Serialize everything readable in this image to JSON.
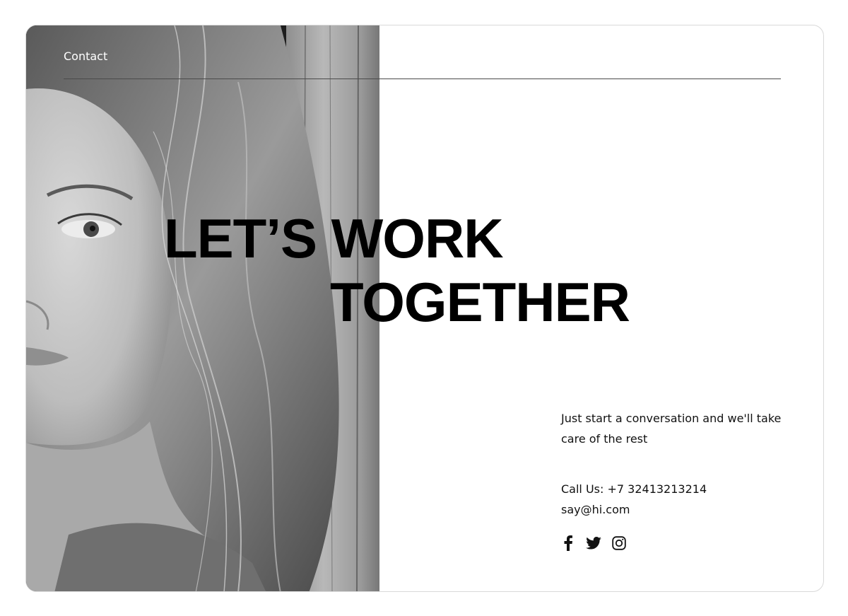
{
  "nav": {
    "contact_label": "Contact"
  },
  "hero": {
    "headline_line1": "LET’S WORK",
    "headline_line2": "TOGETHER"
  },
  "info": {
    "tagline": "Just start a conversation and we'll take care of the rest",
    "phone": "Call Us: +7 32413213214",
    "email": "say@hi.com"
  },
  "socials": [
    {
      "icon": "facebook-icon"
    },
    {
      "icon": "twitter-icon"
    },
    {
      "icon": "instagram-icon"
    }
  ],
  "colors": {
    "background": "#ffffff",
    "text": "#000000",
    "accent_line": "#4a4a4a"
  }
}
